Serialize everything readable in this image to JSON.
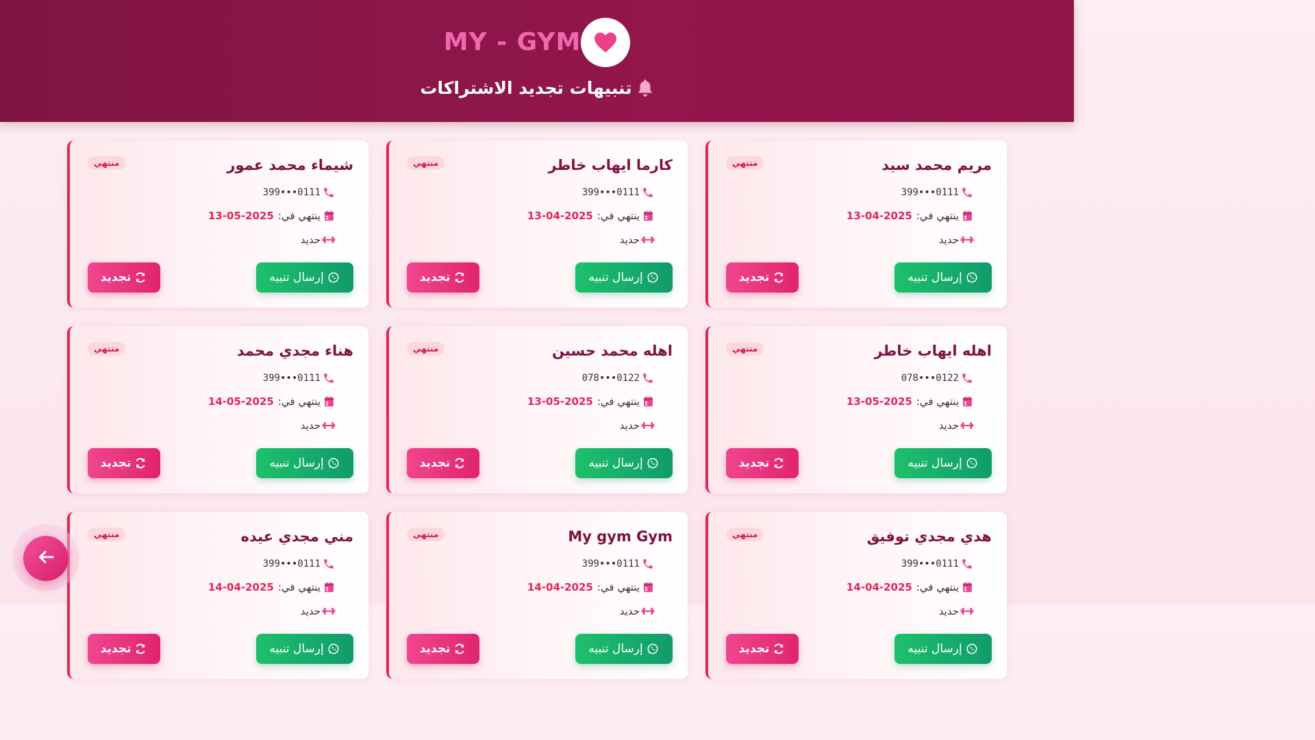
{
  "header": {
    "brand": "MY - GYM",
    "subtitle": "تنبيهات تجديد الاشتراكات",
    "brand_color": "#f168b0",
    "bg_color": "#8f1448"
  },
  "labels": {
    "expiry_prefix": "ينتهي في:",
    "send_button": "إرسال تنبيه",
    "renew_button": "تجديد"
  },
  "cards": [
    {
      "name": "مريم محمد سيد",
      "status": "منتهي",
      "phone": "399•••0111",
      "expiry": "13-04-2025",
      "kind": "حديد"
    },
    {
      "name": "كارما ايهاب خاطر",
      "status": "منتهي",
      "phone": "399•••0111",
      "expiry": "13-04-2025",
      "kind": "حديد"
    },
    {
      "name": "شيماء محمد عمور",
      "status": "منتهي",
      "phone": "399•••0111",
      "expiry": "13-05-2025",
      "kind": "حديد"
    },
    {
      "name": "اهله ايهاب خاطر",
      "status": "منتهي",
      "phone": "078•••0122",
      "expiry": "13-05-2025",
      "kind": "حديد"
    },
    {
      "name": "اهله محمد حسين",
      "status": "منتهي",
      "phone": "078•••0122",
      "expiry": "13-05-2025",
      "kind": "حديد"
    },
    {
      "name": "هناء مجدي محمد",
      "status": "منتهي",
      "phone": "399•••0111",
      "expiry": "14-05-2025",
      "kind": "حديد"
    },
    {
      "name": "هدي مجدي توفيق",
      "status": "منتهي",
      "phone": "399•••0111",
      "expiry": "14-04-2025",
      "kind": "حديد"
    },
    {
      "name": "My gym Gym",
      "status": "منتهي",
      "phone": "399•••0111",
      "expiry": "14-04-2025",
      "kind": "حديد"
    },
    {
      "name": "مني مجدي عيده",
      "status": "منتهي",
      "phone": "399•••0111",
      "expiry": "14-04-2025",
      "kind": "حديد"
    }
  ],
  "icons": {
    "brand": "heart-icon",
    "subtitle": "bell-icon",
    "phone": "phone-icon",
    "expiry": "calendar-icon",
    "kind": "dumbbell-icon",
    "send": "whatsapp-icon",
    "renew": "refresh-icon",
    "back": "arrow-left-icon"
  },
  "colors": {
    "accent_pink": "#e0245e",
    "send_green": "#1ec06b",
    "renew_pink": "#f0468f"
  }
}
